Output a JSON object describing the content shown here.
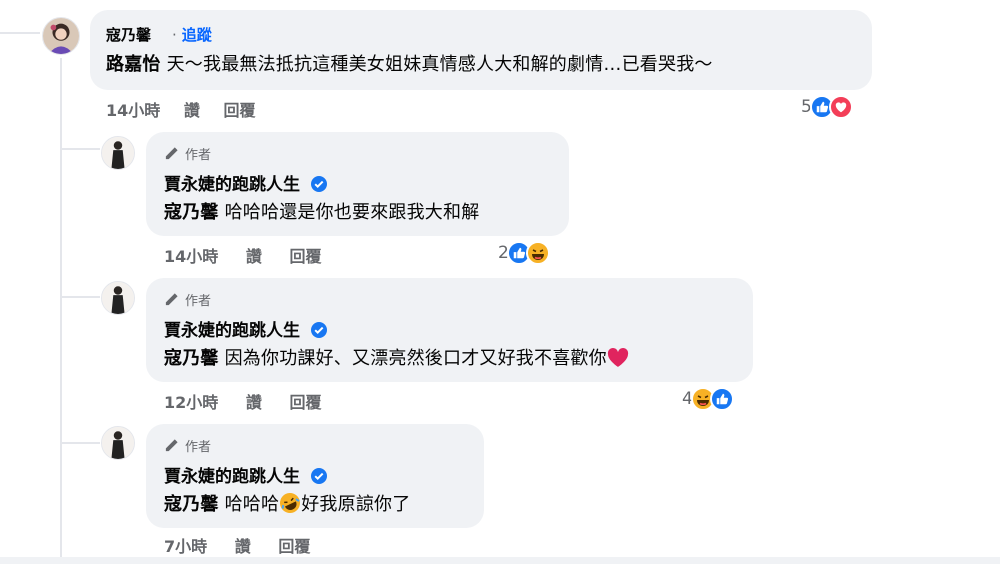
{
  "top_comment": {
    "author": "寇乃馨",
    "follow_separator": "·",
    "follow_label": "追蹤",
    "mention": "路嘉怡",
    "text": "天～我最無法抵抗這種美女姐妹真情感人大和解的劇情…已看哭我～",
    "time": "14小時",
    "like_label": "讚",
    "reply_label": "回覆",
    "reaction_count": "5",
    "reactions": [
      "like-icon",
      "love-icon"
    ]
  },
  "replies": [
    {
      "author_tag": "作者",
      "author": "賈永婕的跑跳人生",
      "mention": "寇乃馨",
      "text": "哈哈哈還是你也要來跟我大和解",
      "time": "14小時",
      "like_label": "讚",
      "reply_label": "回覆",
      "reaction_count": "2",
      "reactions": [
        "like-icon",
        "haha-icon"
      ]
    },
    {
      "author_tag": "作者",
      "author": "賈永婕的跑跳人生",
      "mention": "寇乃馨",
      "text": "因為你功課好、又漂亮然後口才又好我不喜歡你",
      "text_emoji": "red-heart-emoji",
      "time": "12小時",
      "like_label": "讚",
      "reply_label": "回覆",
      "reaction_count": "4",
      "reactions": [
        "haha-icon",
        "like-icon"
      ]
    },
    {
      "author_tag": "作者",
      "author": "賈永婕的跑跳人生",
      "mention": "寇乃馨",
      "text_before": "哈哈哈",
      "text_emoji": "rofl-emoji",
      "text_after": "好我原諒你了",
      "time": "7小時",
      "like_label": "讚",
      "reply_label": "回覆"
    }
  ],
  "colors": {
    "bubble": "#f0f2f5",
    "link_blue": "#0866ff",
    "meta_gray": "#65676b",
    "thread_line": "#e4e6eb"
  }
}
